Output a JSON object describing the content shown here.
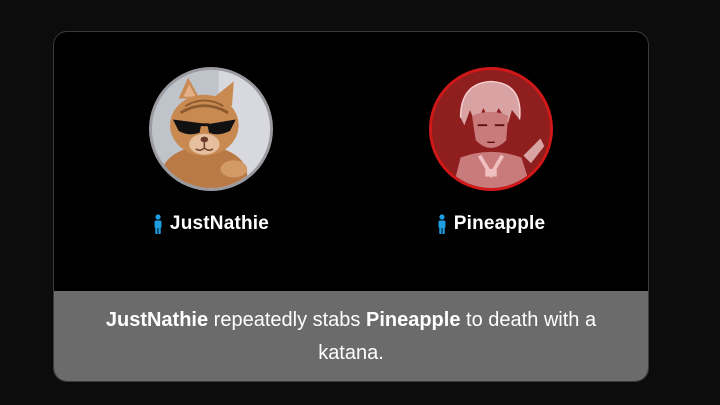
{
  "tributes": [
    {
      "name": "JustNathie",
      "status": "alive",
      "icon": "person-icon",
      "icon_color": "#1e9ee0"
    },
    {
      "name": "Pineapple",
      "status": "dead",
      "icon": "person-icon",
      "icon_color": "#1e9ee0",
      "status_color": "#d01818"
    }
  ],
  "event": {
    "actor": "JustNathie",
    "middle": " repeatedly stabs ",
    "target": "Pineapple",
    "end": " to death with a katana."
  },
  "colors": {
    "page_background": "#0c0c0d",
    "card_background": "#000000",
    "event_background": "#6b6b6b",
    "dead_border": "#d01818",
    "alive_border": "#9a9aa0"
  }
}
